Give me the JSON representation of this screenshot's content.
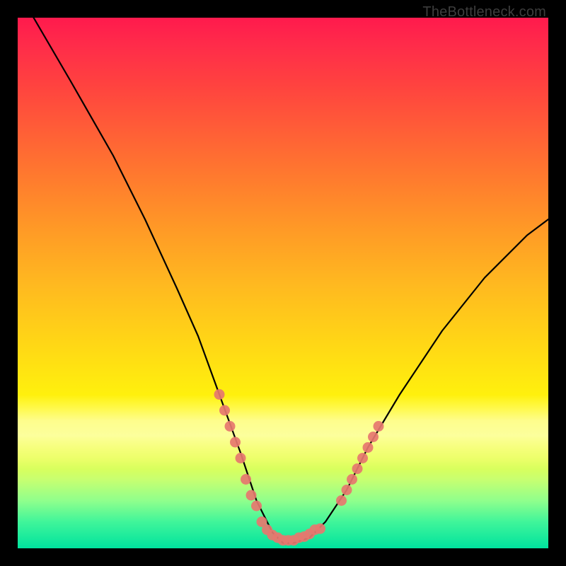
{
  "watermark": "TheBottleneck.com",
  "chart_data": {
    "type": "line",
    "title": "",
    "xlabel": "",
    "ylabel": "",
    "xlim": [
      0,
      100
    ],
    "ylim": [
      0,
      100
    ],
    "grid": false,
    "note": "V-shaped bottleneck curve over a vertical red→green gradient; axis values are not labeled in the image so positions are approximate on a 0–100 scale.",
    "series": [
      {
        "name": "bottleneck-curve",
        "x": [
          3,
          10,
          18,
          24,
          30,
          34,
          38,
          42,
          45,
          48,
          50,
          52,
          55,
          58,
          62,
          66,
          72,
          80,
          88,
          96,
          100
        ],
        "y": [
          100,
          88,
          74,
          62,
          49,
          40,
          29,
          18,
          9,
          3,
          1,
          1,
          2,
          5,
          11,
          19,
          29,
          41,
          51,
          59,
          62
        ]
      }
    ],
    "highlight_points": {
      "name": "salmon-dots",
      "note": "Clusters of salmon markers along the curve near the trough and lower slopes.",
      "points": [
        {
          "x": 38,
          "y": 29
        },
        {
          "x": 39,
          "y": 26
        },
        {
          "x": 40,
          "y": 23
        },
        {
          "x": 41,
          "y": 20
        },
        {
          "x": 42,
          "y": 17
        },
        {
          "x": 43,
          "y": 13
        },
        {
          "x": 44,
          "y": 10
        },
        {
          "x": 45,
          "y": 8
        },
        {
          "x": 46,
          "y": 5
        },
        {
          "x": 47,
          "y": 3.5
        },
        {
          "x": 48,
          "y": 2.5
        },
        {
          "x": 49,
          "y": 2
        },
        {
          "x": 50,
          "y": 1.5
        },
        {
          "x": 51,
          "y": 1.5
        },
        {
          "x": 52,
          "y": 1.5
        },
        {
          "x": 53,
          "y": 2
        },
        {
          "x": 54,
          "y": 2.2
        },
        {
          "x": 55,
          "y": 2.7
        },
        {
          "x": 56,
          "y": 3.5
        },
        {
          "x": 57,
          "y": 3.7
        },
        {
          "x": 61,
          "y": 9
        },
        {
          "x": 62,
          "y": 11
        },
        {
          "x": 63,
          "y": 13
        },
        {
          "x": 64,
          "y": 15
        },
        {
          "x": 65,
          "y": 17
        },
        {
          "x": 66,
          "y": 19
        },
        {
          "x": 67,
          "y": 21
        },
        {
          "x": 68,
          "y": 23
        }
      ]
    },
    "colors": {
      "curve": "#000000",
      "dots": "#e6776f",
      "gradient_top": "#ff1a4d",
      "gradient_bottom": "#00e39e"
    }
  }
}
